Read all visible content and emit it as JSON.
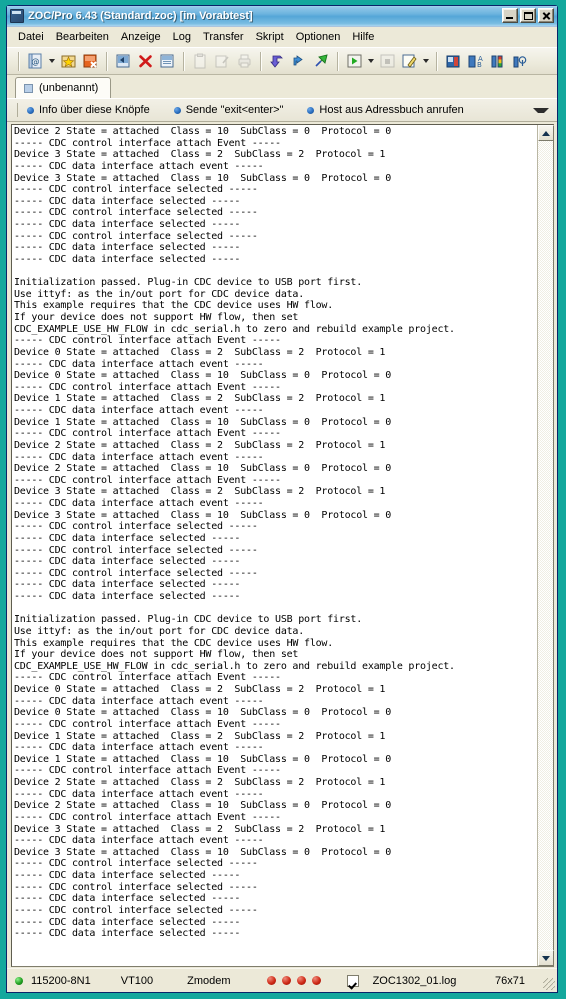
{
  "window": {
    "title": "ZOC/Pro 6.43 (Standard.zoc) [im Vorabtest]",
    "minimize_label": "Minimieren",
    "maximize_label": "Maximieren",
    "close_label": "Schliessen"
  },
  "menu": [
    "Datei",
    "Bearbeiten",
    "Anzeige",
    "Log",
    "Transfer",
    "Skript",
    "Optionen",
    "Hilfe"
  ],
  "toolbar": [
    {
      "name": "address-book-icon",
      "tip": "Adressbuch"
    },
    {
      "name": "address-book-dropdown-arrow",
      "tip": "Adressbuch Auswahl"
    },
    {
      "name": "favorite-star-icon",
      "tip": "Favorit hinzufuegen"
    },
    {
      "name": "close-connection-icon",
      "tip": "Verbindung trennen"
    },
    {
      "name": "connect-icon",
      "tip": "Verbinden"
    },
    {
      "name": "disconnect-icon",
      "tip": "Trennen"
    },
    {
      "name": "new-window-icon",
      "tip": "Neues Fenster"
    },
    {
      "name": "paste-icon",
      "tip": "Einfuegen"
    },
    {
      "name": "edit-clipboard-icon",
      "tip": "Zwischenablage bearbeiten"
    },
    {
      "name": "print-icon",
      "tip": "Drucken"
    },
    {
      "name": "receive-file-icon",
      "tip": "Datei empfangen"
    },
    {
      "name": "send-file-icon",
      "tip": "Datei senden"
    },
    {
      "name": "zmodem-upload-icon",
      "tip": "Zmodem Upload"
    },
    {
      "name": "run-script-icon",
      "tip": "Skript ausfuehren"
    },
    {
      "name": "run-script-dropdown-arrow",
      "tip": "Skript Auswahl"
    },
    {
      "name": "stop-script-icon",
      "tip": "Skript anhalten"
    },
    {
      "name": "edit-script-icon",
      "tip": "Skript bearbeiten"
    },
    {
      "name": "edit-script-dropdown-arrow",
      "tip": "Skript Editor Auswahl"
    },
    {
      "name": "session-profile-icon",
      "tip": "Sitzungsprofil"
    },
    {
      "name": "font-settings-icon",
      "tip": "Schrift"
    },
    {
      "name": "color-settings-icon",
      "tip": "Farben"
    },
    {
      "name": "terminal-options-icon",
      "tip": "Terminal Optionen"
    }
  ],
  "tabs": [
    {
      "label": "(unbenannt)",
      "icon": "terminal-tab-icon",
      "active": true
    }
  ],
  "buttonbar": {
    "items": [
      {
        "label": "Info über diese Knöpfe"
      },
      {
        "label": "Sende \"exit<enter>\""
      },
      {
        "label": "Host aus Adressbuch anrufen"
      }
    ],
    "more_icon": "expand-buttonbar-icon"
  },
  "terminal": {
    "lines": [
      "Device 2 State = attached  Class = 10  SubClass = 0  Protocol = 0",
      "----- CDC control interface attach Event -----",
      "Device 3 State = attached  Class = 2  SubClass = 2  Protocol = 1",
      "----- CDC data interface attach event -----",
      "Device 3 State = attached  Class = 10  SubClass = 0  Protocol = 0",
      "----- CDC control interface selected -----",
      "----- CDC data interface selected -----",
      "----- CDC control interface selected -----",
      "----- CDC data interface selected -----",
      "----- CDC control interface selected -----",
      "----- CDC data interface selected -----",
      "----- CDC data interface selected -----",
      "",
      "Initialization passed. Plug-in CDC device to USB port first.",
      "Use ittyf: as the in/out port for CDC device data.",
      "This example requires that the CDC device uses HW flow.",
      "If your device does not support HW flow, then set",
      "CDC_EXAMPLE_USE_HW_FLOW in cdc_serial.h to zero and rebuild example project.",
      "----- CDC control interface attach Event -----",
      "Device 0 State = attached  Class = 2  SubClass = 2  Protocol = 1",
      "----- CDC data interface attach event -----",
      "Device 0 State = attached  Class = 10  SubClass = 0  Protocol = 0",
      "----- CDC control interface attach Event -----",
      "Device 1 State = attached  Class = 2  SubClass = 2  Protocol = 1",
      "----- CDC data interface attach event -----",
      "Device 1 State = attached  Class = 10  SubClass = 0  Protocol = 0",
      "----- CDC control interface attach Event -----",
      "Device 2 State = attached  Class = 2  SubClass = 2  Protocol = 1",
      "----- CDC data interface attach event -----",
      "Device 2 State = attached  Class = 10  SubClass = 0  Protocol = 0",
      "----- CDC control interface attach Event -----",
      "Device 3 State = attached  Class = 2  SubClass = 2  Protocol = 1",
      "----- CDC data interface attach event -----",
      "Device 3 State = attached  Class = 10  SubClass = 0  Protocol = 0",
      "----- CDC control interface selected -----",
      "----- CDC data interface selected -----",
      "----- CDC control interface selected -----",
      "----- CDC data interface selected -----",
      "----- CDC control interface selected -----",
      "----- CDC data interface selected -----",
      "----- CDC data interface selected -----",
      "",
      "Initialization passed. Plug-in CDC device to USB port first.",
      "Use ittyf: as the in/out port for CDC device data.",
      "This example requires that the CDC device uses HW flow.",
      "If your device does not support HW flow, then set",
      "CDC_EXAMPLE_USE_HW_FLOW in cdc_serial.h to zero and rebuild example project.",
      "----- CDC control interface attach Event -----",
      "Device 0 State = attached  Class = 2  SubClass = 2  Protocol = 1",
      "----- CDC data interface attach event -----",
      "Device 0 State = attached  Class = 10  SubClass = 0  Protocol = 0",
      "----- CDC control interface attach Event -----",
      "Device 1 State = attached  Class = 2  SubClass = 2  Protocol = 1",
      "----- CDC data interface attach event -----",
      "Device 1 State = attached  Class = 10  SubClass = 0  Protocol = 0",
      "----- CDC control interface attach Event -----",
      "Device 2 State = attached  Class = 2  SubClass = 2  Protocol = 1",
      "----- CDC data interface attach event -----",
      "Device 2 State = attached  Class = 10  SubClass = 0  Protocol = 0",
      "----- CDC control interface attach Event -----",
      "Device 3 State = attached  Class = 2  SubClass = 2  Protocol = 1",
      "----- CDC data interface attach event -----",
      "Device 3 State = attached  Class = 10  SubClass = 0  Protocol = 0",
      "----- CDC control interface selected -----",
      "----- CDC data interface selected -----",
      "----- CDC control interface selected -----",
      "----- CDC data interface selected -----",
      "----- CDC control interface selected -----",
      "----- CDC data interface selected -----",
      "----- CDC data interface selected -----"
    ]
  },
  "scrollbar": {
    "up_icon": "scroll-up-arrow-icon",
    "down_icon": "scroll-down-arrow-icon"
  },
  "statusbar": {
    "connection_led": "green",
    "baud": "115200-8N1",
    "emulation": "VT100",
    "transfer": "Zmodem",
    "leds": [
      "red",
      "red",
      "red",
      "red"
    ],
    "log_checked": true,
    "log_file": "ZOC1302_01.log",
    "size": "76x71"
  },
  "colors": {
    "desktop": "#14a89d",
    "window_face": "#ece9d8",
    "title_active": "#54a6d7",
    "terminal_bg": "#ffffff",
    "terminal_fg": "#000000",
    "led_green": "#23a023",
    "led_red": "#cf2a17"
  }
}
